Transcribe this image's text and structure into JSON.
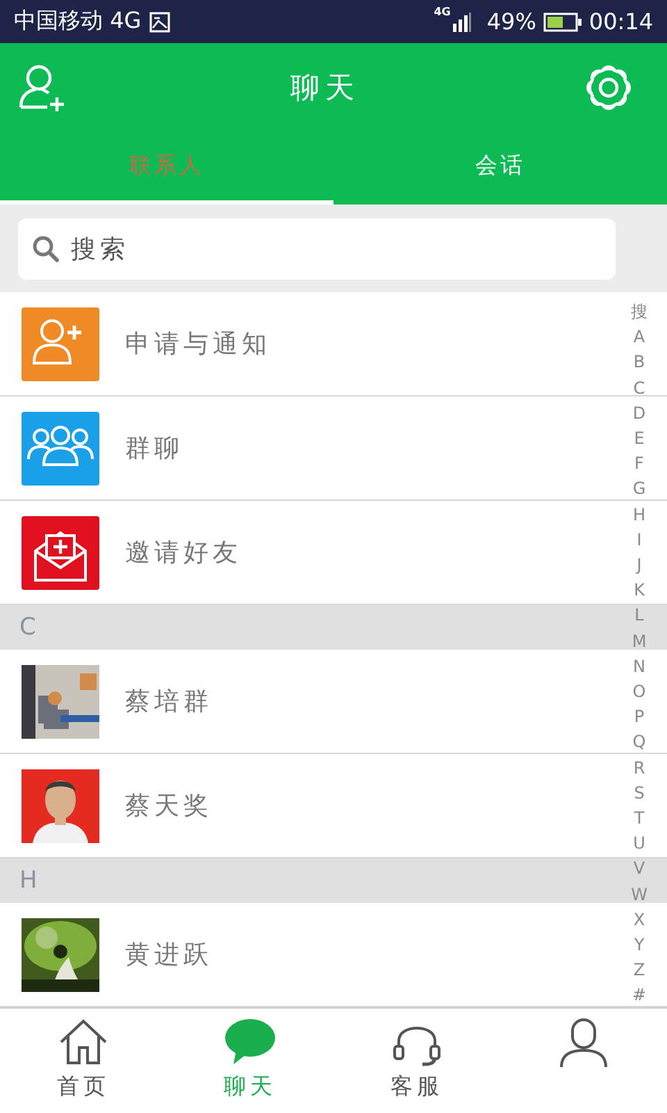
{
  "status_bar": {
    "carrier": "中国移动 4G",
    "network": "4G",
    "battery": "49%",
    "time": "00:14"
  },
  "header": {
    "title": "聊天"
  },
  "tabs": [
    {
      "label": "联系人",
      "selected": true
    },
    {
      "label": "会话",
      "selected": false
    }
  ],
  "search": {
    "placeholder": "搜索"
  },
  "list": [
    {
      "kind": "entry",
      "name": "申请与通知"
    },
    {
      "kind": "entry",
      "name": "群聊"
    },
    {
      "kind": "entry",
      "name": "邀请好友"
    },
    {
      "kind": "section",
      "label": "C"
    },
    {
      "kind": "contact",
      "name": "蔡培群"
    },
    {
      "kind": "contact",
      "name": "蔡天奖"
    },
    {
      "kind": "section",
      "label": "H"
    },
    {
      "kind": "contact",
      "name": "黄进跃"
    }
  ],
  "index_bar": [
    "搜",
    "A",
    "B",
    "C",
    "D",
    "E",
    "F",
    "G",
    "H",
    "I",
    "J",
    "K",
    "L",
    "M",
    "N",
    "O",
    "P",
    "Q",
    "R",
    "S",
    "T",
    "U",
    "V",
    "W",
    "X",
    "Y",
    "Z",
    "#"
  ],
  "bottom_nav": [
    {
      "label": "首页",
      "selected": false
    },
    {
      "label": "聊天",
      "selected": true
    },
    {
      "label": "客服",
      "selected": false
    },
    {
      "selected": false
    }
  ]
}
